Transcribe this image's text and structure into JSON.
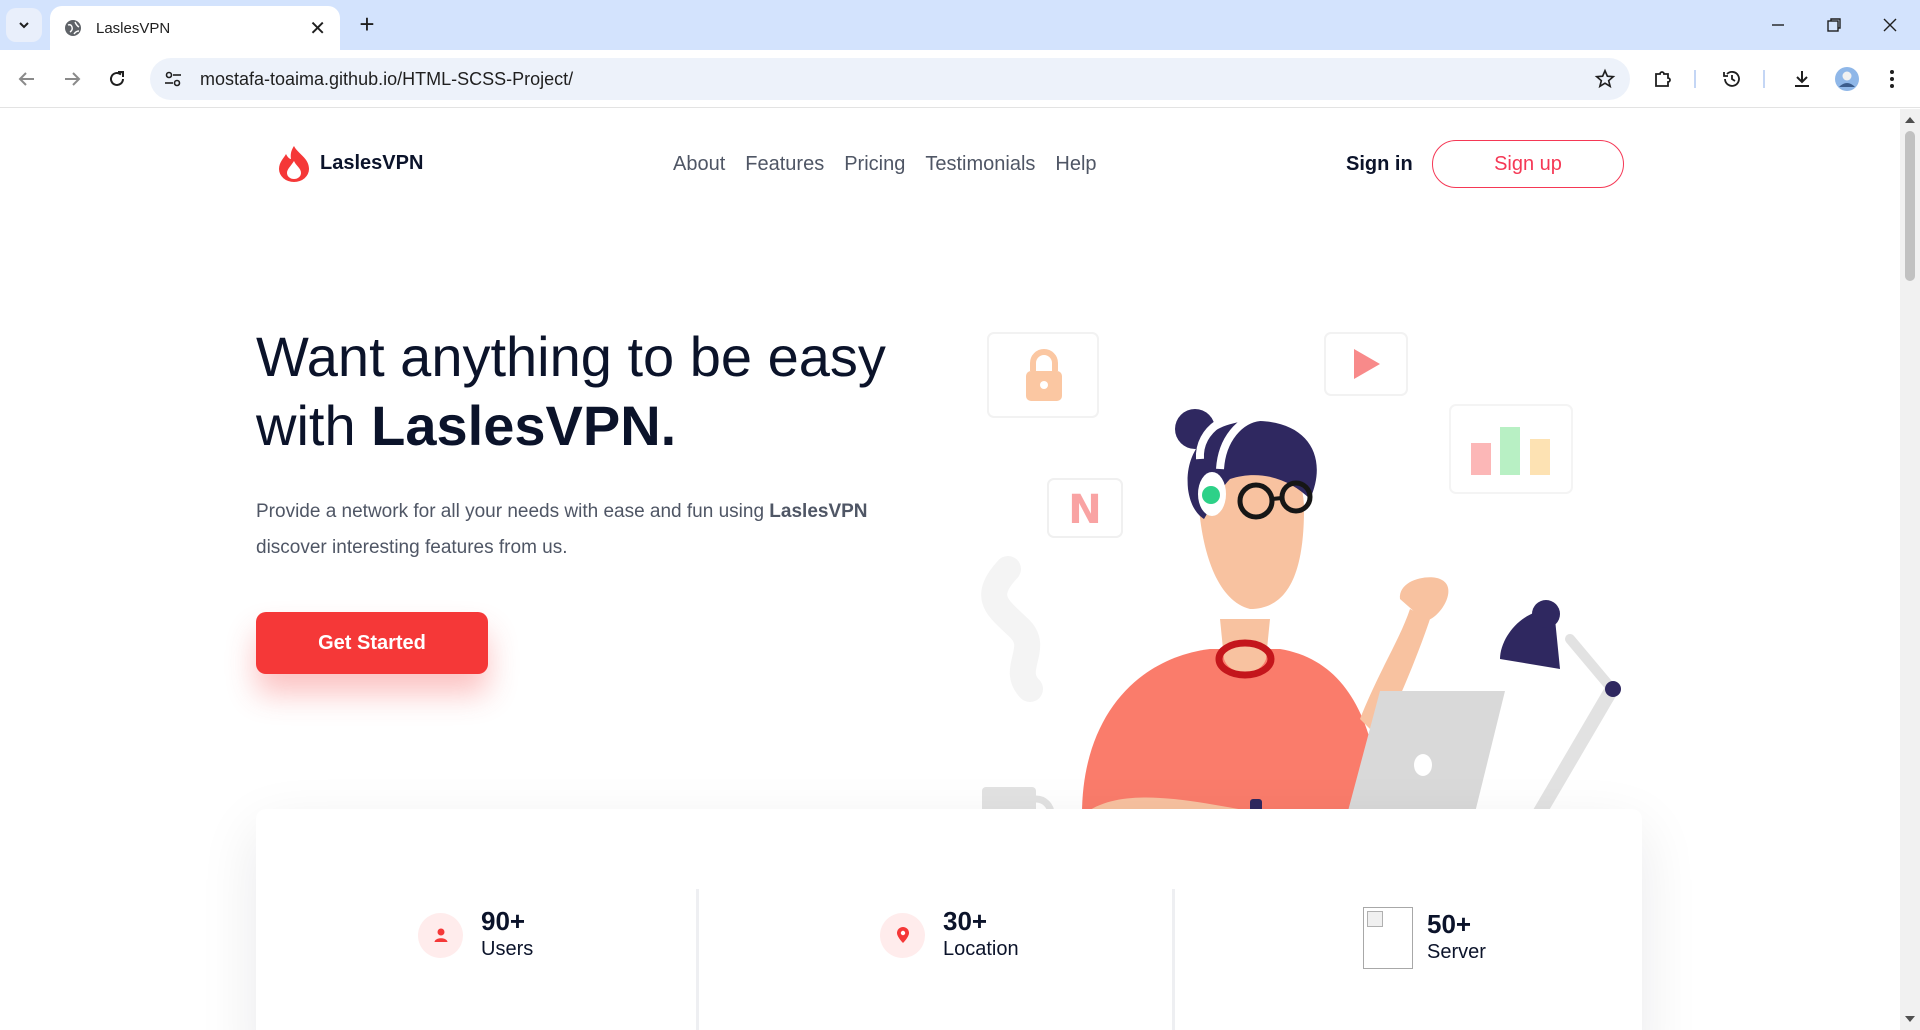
{
  "browser": {
    "tab_title": "LaslesVPN",
    "url": "mostafa-toaima.github.io/HTML-SCSS-Project/"
  },
  "site": {
    "brand": "LaslesVPN",
    "nav": [
      "About",
      "Features",
      "Pricing",
      "Testimonials",
      "Help"
    ],
    "signin": "Sign in",
    "signup": "Sign up",
    "hero_title_part1": "Want anything to be easy with ",
    "hero_title_brand": "LaslesVPN.",
    "hero_text_part1": "Provide a network for all your needs with ease and fun using ",
    "hero_text_brand": "LaslesVPN",
    "hero_text_part2": " discover interesting features from us.",
    "cta": "Get Started"
  },
  "stats": [
    {
      "value": "90+",
      "label": "Users",
      "icon": "user-icon"
    },
    {
      "value": "30+",
      "label": "Location",
      "icon": "location-pin-icon"
    },
    {
      "value": "50+",
      "label": "Server",
      "icon": "broken-image-icon"
    }
  ],
  "colors": {
    "accent": "#f53838",
    "tabbar": "#d3e3fd",
    "dark_text": "#0b132a",
    "body_text": "#4f5665"
  }
}
